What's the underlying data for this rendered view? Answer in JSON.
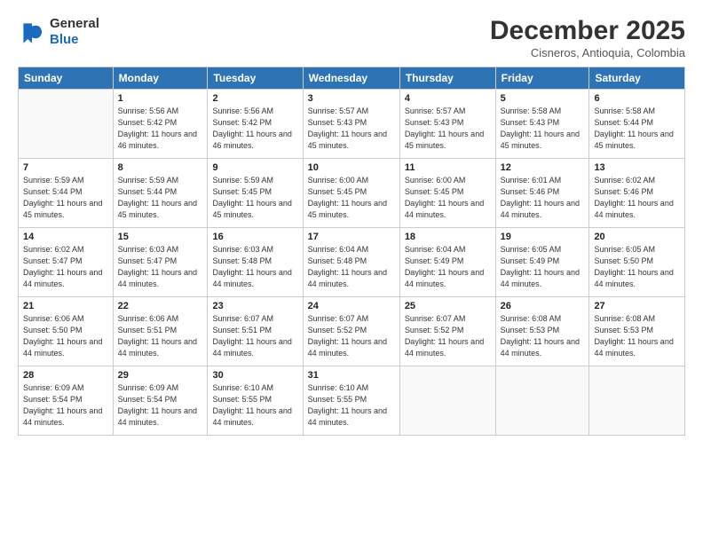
{
  "logo": {
    "line1": "General",
    "line2": "Blue"
  },
  "title": "December 2025",
  "subtitle": "Cisneros, Antioquia, Colombia",
  "days_header": [
    "Sunday",
    "Monday",
    "Tuesday",
    "Wednesday",
    "Thursday",
    "Friday",
    "Saturday"
  ],
  "weeks": [
    [
      {
        "day": "",
        "info": ""
      },
      {
        "day": "1",
        "info": "Sunrise: 5:56 AM\nSunset: 5:42 PM\nDaylight: 11 hours\nand 46 minutes."
      },
      {
        "day": "2",
        "info": "Sunrise: 5:56 AM\nSunset: 5:42 PM\nDaylight: 11 hours\nand 46 minutes."
      },
      {
        "day": "3",
        "info": "Sunrise: 5:57 AM\nSunset: 5:43 PM\nDaylight: 11 hours\nand 45 minutes."
      },
      {
        "day": "4",
        "info": "Sunrise: 5:57 AM\nSunset: 5:43 PM\nDaylight: 11 hours\nand 45 minutes."
      },
      {
        "day": "5",
        "info": "Sunrise: 5:58 AM\nSunset: 5:43 PM\nDaylight: 11 hours\nand 45 minutes."
      },
      {
        "day": "6",
        "info": "Sunrise: 5:58 AM\nSunset: 5:44 PM\nDaylight: 11 hours\nand 45 minutes."
      }
    ],
    [
      {
        "day": "7",
        "info": "Sunrise: 5:59 AM\nSunset: 5:44 PM\nDaylight: 11 hours\nand 45 minutes."
      },
      {
        "day": "8",
        "info": "Sunrise: 5:59 AM\nSunset: 5:44 PM\nDaylight: 11 hours\nand 45 minutes."
      },
      {
        "day": "9",
        "info": "Sunrise: 5:59 AM\nSunset: 5:45 PM\nDaylight: 11 hours\nand 45 minutes."
      },
      {
        "day": "10",
        "info": "Sunrise: 6:00 AM\nSunset: 5:45 PM\nDaylight: 11 hours\nand 45 minutes."
      },
      {
        "day": "11",
        "info": "Sunrise: 6:00 AM\nSunset: 5:45 PM\nDaylight: 11 hours\nand 44 minutes."
      },
      {
        "day": "12",
        "info": "Sunrise: 6:01 AM\nSunset: 5:46 PM\nDaylight: 11 hours\nand 44 minutes."
      },
      {
        "day": "13",
        "info": "Sunrise: 6:02 AM\nSunset: 5:46 PM\nDaylight: 11 hours\nand 44 minutes."
      }
    ],
    [
      {
        "day": "14",
        "info": "Sunrise: 6:02 AM\nSunset: 5:47 PM\nDaylight: 11 hours\nand 44 minutes."
      },
      {
        "day": "15",
        "info": "Sunrise: 6:03 AM\nSunset: 5:47 PM\nDaylight: 11 hours\nand 44 minutes."
      },
      {
        "day": "16",
        "info": "Sunrise: 6:03 AM\nSunset: 5:48 PM\nDaylight: 11 hours\nand 44 minutes."
      },
      {
        "day": "17",
        "info": "Sunrise: 6:04 AM\nSunset: 5:48 PM\nDaylight: 11 hours\nand 44 minutes."
      },
      {
        "day": "18",
        "info": "Sunrise: 6:04 AM\nSunset: 5:49 PM\nDaylight: 11 hours\nand 44 minutes."
      },
      {
        "day": "19",
        "info": "Sunrise: 6:05 AM\nSunset: 5:49 PM\nDaylight: 11 hours\nand 44 minutes."
      },
      {
        "day": "20",
        "info": "Sunrise: 6:05 AM\nSunset: 5:50 PM\nDaylight: 11 hours\nand 44 minutes."
      }
    ],
    [
      {
        "day": "21",
        "info": "Sunrise: 6:06 AM\nSunset: 5:50 PM\nDaylight: 11 hours\nand 44 minutes."
      },
      {
        "day": "22",
        "info": "Sunrise: 6:06 AM\nSunset: 5:51 PM\nDaylight: 11 hours\nand 44 minutes."
      },
      {
        "day": "23",
        "info": "Sunrise: 6:07 AM\nSunset: 5:51 PM\nDaylight: 11 hours\nand 44 minutes."
      },
      {
        "day": "24",
        "info": "Sunrise: 6:07 AM\nSunset: 5:52 PM\nDaylight: 11 hours\nand 44 minutes."
      },
      {
        "day": "25",
        "info": "Sunrise: 6:07 AM\nSunset: 5:52 PM\nDaylight: 11 hours\nand 44 minutes."
      },
      {
        "day": "26",
        "info": "Sunrise: 6:08 AM\nSunset: 5:53 PM\nDaylight: 11 hours\nand 44 minutes."
      },
      {
        "day": "27",
        "info": "Sunrise: 6:08 AM\nSunset: 5:53 PM\nDaylight: 11 hours\nand 44 minutes."
      }
    ],
    [
      {
        "day": "28",
        "info": "Sunrise: 6:09 AM\nSunset: 5:54 PM\nDaylight: 11 hours\nand 44 minutes."
      },
      {
        "day": "29",
        "info": "Sunrise: 6:09 AM\nSunset: 5:54 PM\nDaylight: 11 hours\nand 44 minutes."
      },
      {
        "day": "30",
        "info": "Sunrise: 6:10 AM\nSunset: 5:55 PM\nDaylight: 11 hours\nand 44 minutes."
      },
      {
        "day": "31",
        "info": "Sunrise: 6:10 AM\nSunset: 5:55 PM\nDaylight: 11 hours\nand 44 minutes."
      },
      {
        "day": "",
        "info": ""
      },
      {
        "day": "",
        "info": ""
      },
      {
        "day": "",
        "info": ""
      }
    ]
  ]
}
